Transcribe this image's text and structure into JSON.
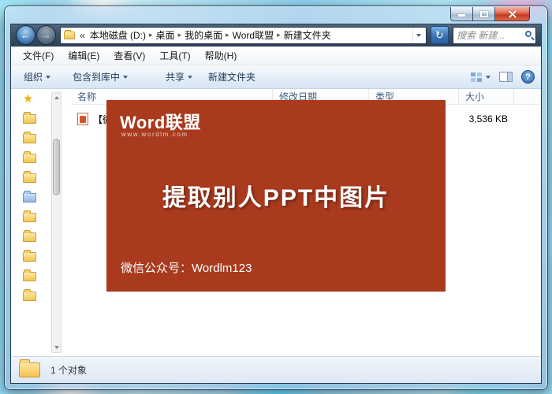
{
  "navbar": {
    "back_icon": "←",
    "forward_icon": "→",
    "refresh_icon": "↻",
    "breadcrumb": {
      "overflow": "«",
      "separator": "▸",
      "items": [
        "本地磁盘 (D:)",
        "桌面",
        "我的桌面",
        "Word联盟",
        "新建文件夹"
      ]
    },
    "search": {
      "placeholder": "搜索 新建..."
    }
  },
  "menubar": {
    "items": [
      "文件(F)",
      "编辑(E)",
      "查看(V)",
      "工具(T)",
      "帮助(H)"
    ]
  },
  "toolbar": {
    "organize": "组织",
    "include_in_library": "包含到库中",
    "share": "共享",
    "new_folder": "新建文件夹",
    "help_glyph": "?"
  },
  "sidebar": {
    "favorites_star": "★"
  },
  "filelist": {
    "columns": [
      "名称",
      "修改日期",
      "类型",
      "大小"
    ],
    "rows": [
      {
        "name": "【微...",
        "date": "",
        "type": "",
        "size": "3,536 KB"
      }
    ]
  },
  "statusbar": {
    "text": "1 个对象"
  },
  "overlay": {
    "logo": "Word联盟",
    "logo_sub": "www.wordlm.com",
    "title": "提取别人PPT中图片",
    "footer": "微信公众号：Wordlm123",
    "bg_color": "#a93a1e"
  },
  "colors": {
    "navbar_bg": "#3a5066",
    "accent_blue": "#2f66a9",
    "close_red": "#c23b22"
  }
}
